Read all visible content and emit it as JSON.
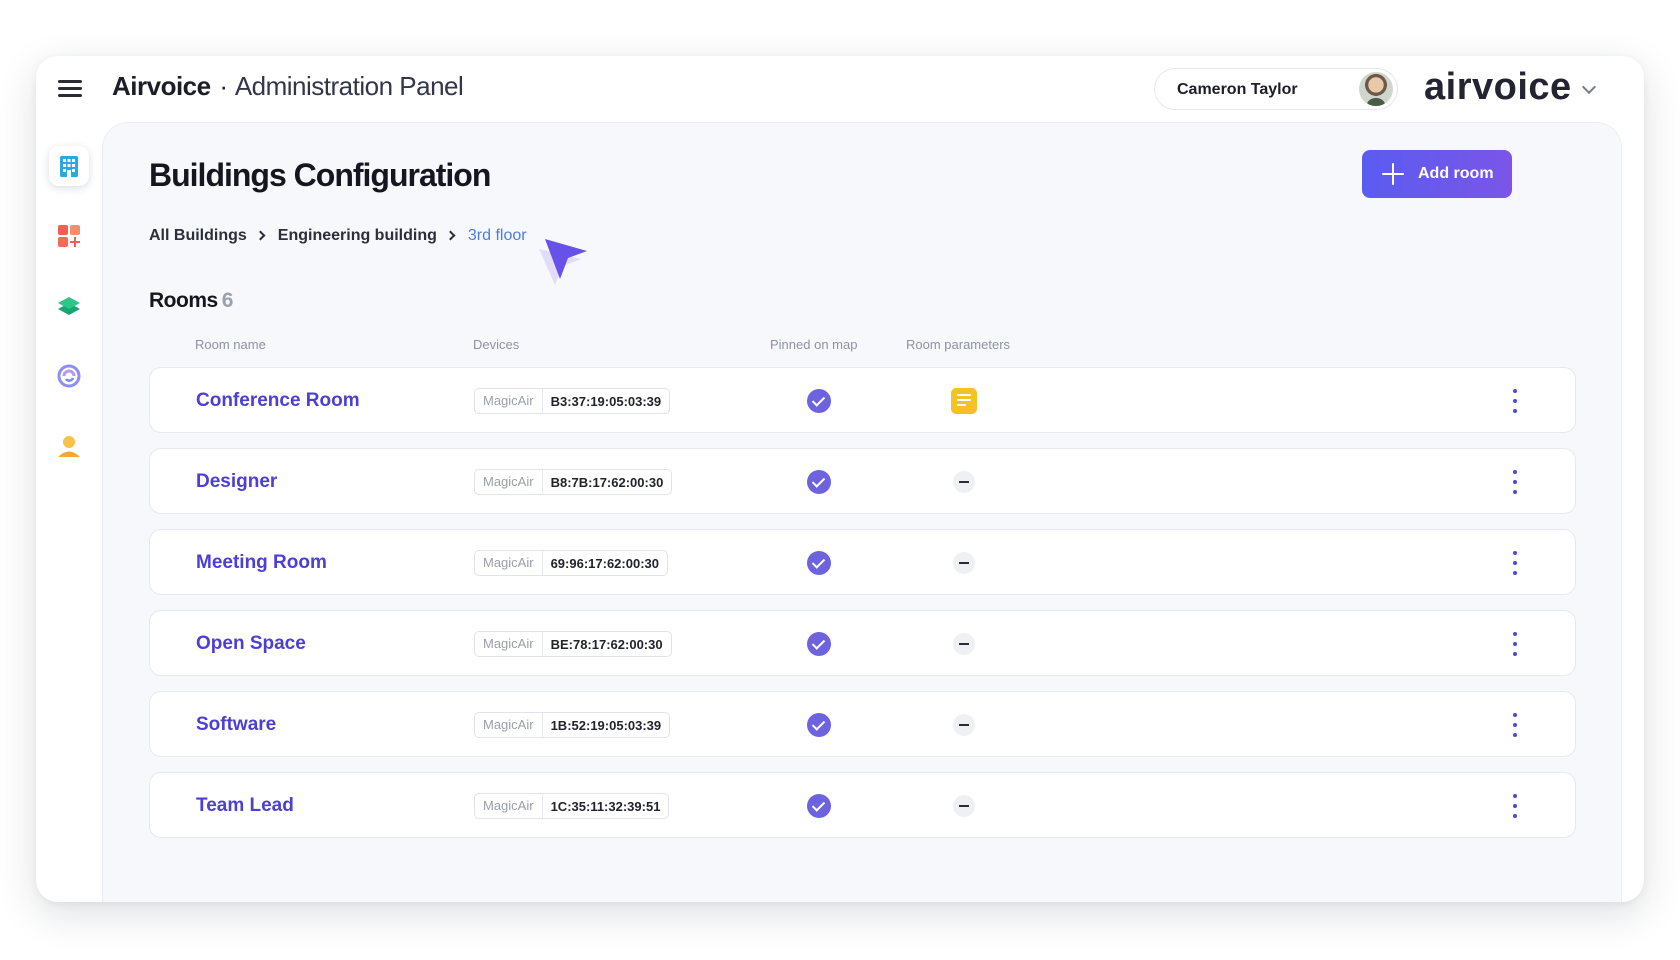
{
  "header": {
    "brand": "Airvoice",
    "separator": "·",
    "subtitle": "Administration Panel",
    "user_name": "Cameron Taylor",
    "logo_text": "airvoice"
  },
  "sidebar": {
    "items": [
      {
        "icon": "building-icon",
        "active": true
      },
      {
        "icon": "widgets-add-icon",
        "active": false
      },
      {
        "icon": "layers-icon",
        "active": false
      },
      {
        "icon": "swirl-icon",
        "active": false
      },
      {
        "icon": "user-icon",
        "active": false
      }
    ]
  },
  "page": {
    "title": "Buildings Configuration",
    "add_button_label": "Add room",
    "breadcrumb": [
      "All Buildings",
      "Engineering building",
      "3rd floor"
    ]
  },
  "rooms": {
    "label": "Rooms",
    "count": "6",
    "columns": [
      "Room name",
      "Devices",
      "Pinned on map",
      "Room parameters"
    ],
    "rows": [
      {
        "name": "Conference Room",
        "device_type": "MagicAir",
        "device_mac": "B3:37:19:05:03:39",
        "pinned": true,
        "has_parameters": true
      },
      {
        "name": "Designer",
        "device_type": "MagicAir",
        "device_mac": "B8:7B:17:62:00:30",
        "pinned": true,
        "has_parameters": false
      },
      {
        "name": "Meeting Room",
        "device_type": "MagicAir",
        "device_mac": "69:96:17:62:00:30",
        "pinned": true,
        "has_parameters": false
      },
      {
        "name": "Open Space",
        "device_type": "MagicAir",
        "device_mac": "BE:78:17:62:00:30",
        "pinned": true,
        "has_parameters": false
      },
      {
        "name": "Software",
        "device_type": "MagicAir",
        "device_mac": "1B:52:19:05:03:39",
        "pinned": true,
        "has_parameters": false
      },
      {
        "name": "Team Lead",
        "device_type": "MagicAir",
        "device_mac": "1C:35:11:32:39:51",
        "pinned": true,
        "has_parameters": false
      }
    ]
  },
  "colors": {
    "accent": "#5a5cf0",
    "room_name": "#4b3fd6",
    "breadcrumb_current": "#4a7de8",
    "pinned_check": "#6d63de",
    "parameter_note": "#f5c125"
  }
}
